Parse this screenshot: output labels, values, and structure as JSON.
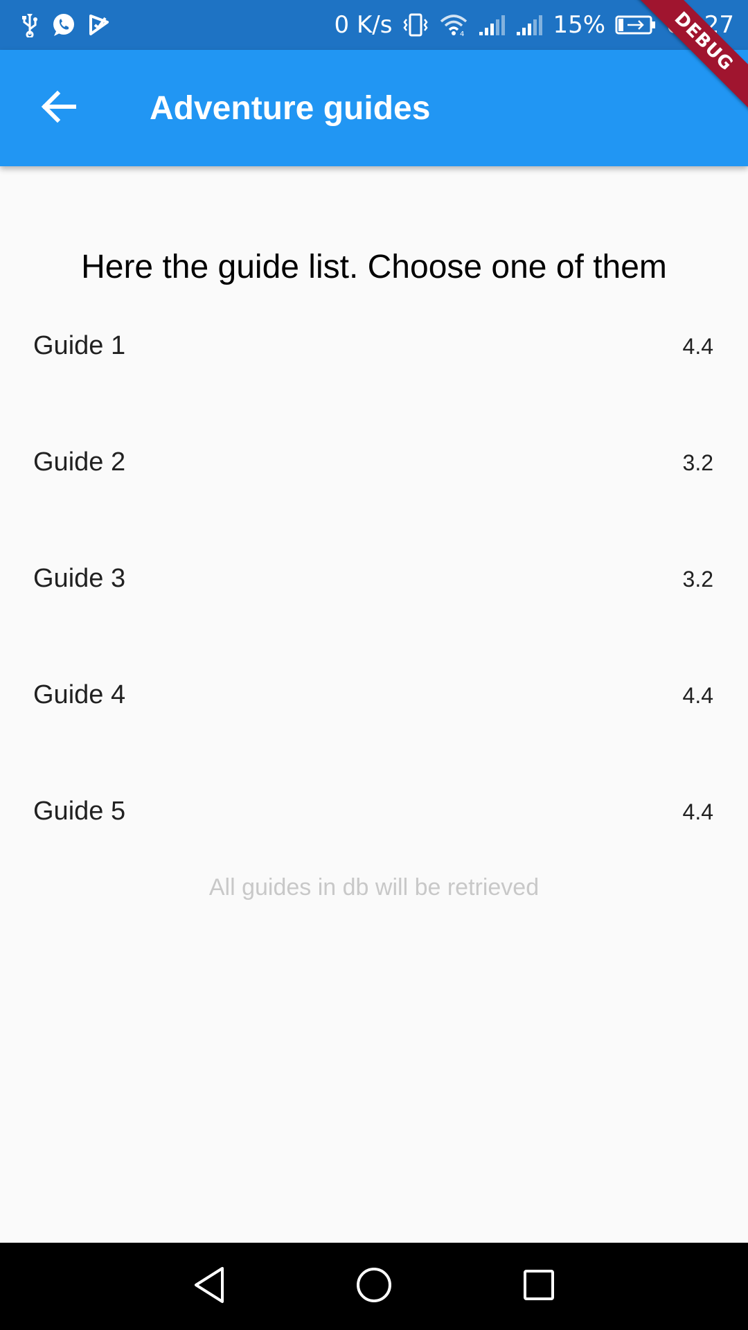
{
  "status_bar": {
    "left_icons": [
      "usb-icon",
      "whatsapp-icon",
      "email-notification-icon"
    ],
    "network_speed": "0 K/s",
    "battery_percent": "15%",
    "time": "00:27",
    "right_icons": [
      "vibrate-icon",
      "wifi-icon",
      "signal-icon",
      "signal-icon",
      "battery-charging-icon"
    ]
  },
  "debug_banner": {
    "label": "DEBUG"
  },
  "app_bar": {
    "title": "Adventure guides",
    "back_icon": "arrow-back-icon",
    "color": "#2196f3"
  },
  "main": {
    "heading": "Here the guide list. Choose one of them",
    "guides": [
      {
        "name": "Guide 1",
        "rating": "4.4"
      },
      {
        "name": "Guide 2",
        "rating": "3.2"
      },
      {
        "name": "Guide 3",
        "rating": "3.2"
      },
      {
        "name": "Guide 4",
        "rating": "4.4"
      },
      {
        "name": "Guide 5",
        "rating": "4.4"
      }
    ],
    "footer_note": "All guides in db will be retrieved"
  },
  "nav_bar": {
    "icons": [
      "nav-back-icon",
      "nav-home-icon",
      "nav-recents-icon"
    ]
  }
}
